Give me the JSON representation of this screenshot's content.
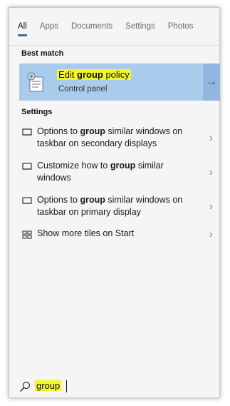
{
  "tabs": [
    {
      "label": "All",
      "active": true
    },
    {
      "label": "Apps",
      "active": false
    },
    {
      "label": "Documents",
      "active": false
    },
    {
      "label": "Settings",
      "active": false
    },
    {
      "label": "Photos",
      "active": false
    }
  ],
  "best_match": {
    "section_label": "Best match",
    "title_prefix": "Edit ",
    "title_bold": "group",
    "title_suffix": " policy",
    "subtitle": "Control panel",
    "icon": "group-policy-icon",
    "arrow_icon": "arrow-right-icon",
    "highlight_color": "#a9ccec"
  },
  "settings": {
    "section_label": "Settings",
    "items": [
      {
        "pre": "Options to ",
        "bold": "group",
        "post": " similar windows on taskbar on secondary displays",
        "icon": "monitor-icon"
      },
      {
        "pre": "Customize how to ",
        "bold": "group",
        "post": " similar windows",
        "icon": "monitor-icon"
      },
      {
        "pre": "Options to ",
        "bold": "group",
        "post": " similar windows on taskbar on primary display",
        "icon": "monitor-icon"
      },
      {
        "pre": "Show more tiles on Start",
        "bold": "",
        "post": "",
        "icon": "tiles-icon"
      }
    ]
  },
  "search": {
    "query": "group",
    "icon": "search-icon"
  },
  "colors": {
    "text_highlight": "#f4f62c",
    "tab_underline": "#3a6ea5"
  }
}
